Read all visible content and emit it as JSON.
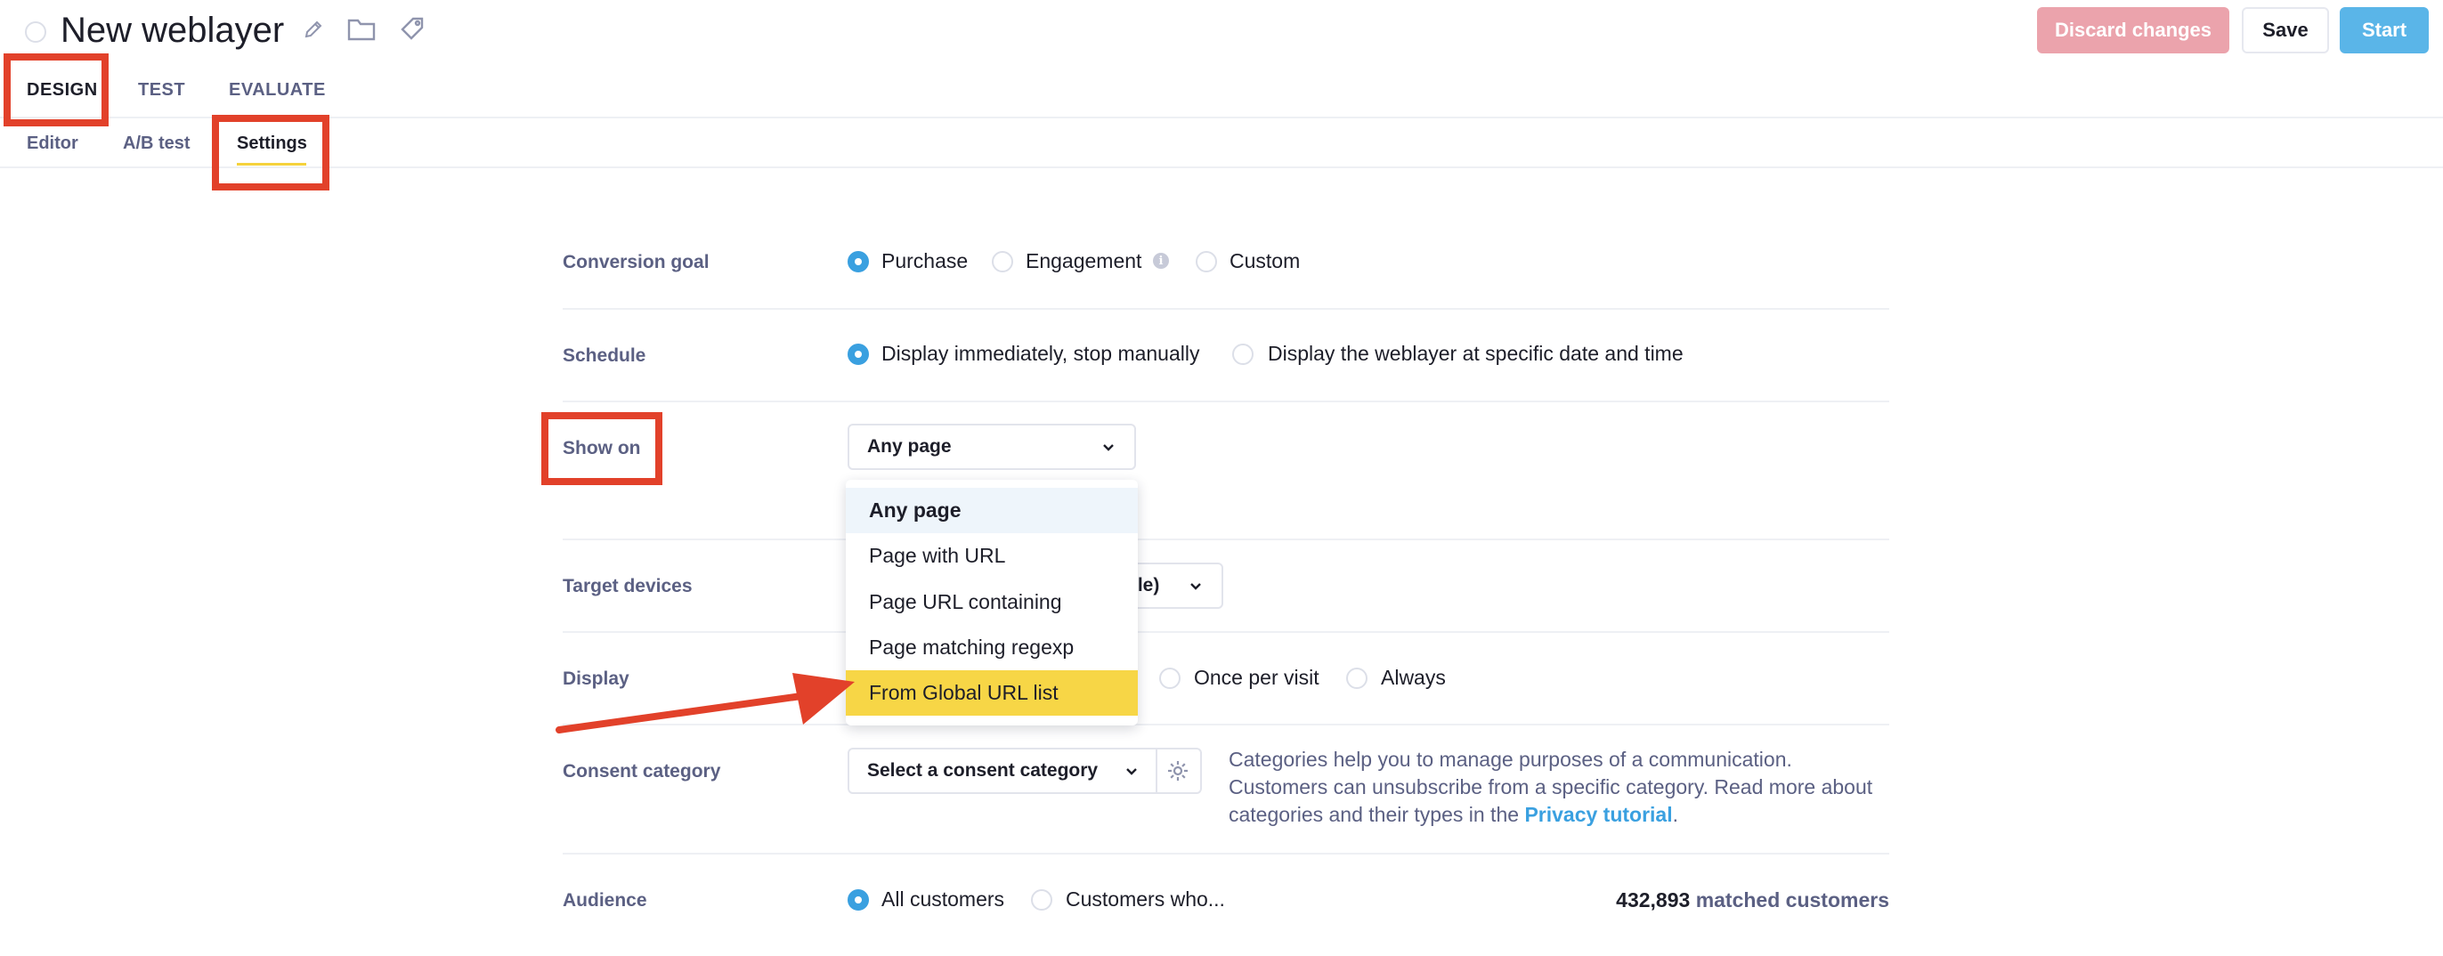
{
  "header": {
    "title": "New weblayer",
    "discard_label": "Discard changes",
    "save_label": "Save",
    "start_label": "Start"
  },
  "top_tabs": [
    {
      "label": "DESIGN",
      "active": true
    },
    {
      "label": "TEST",
      "active": false
    },
    {
      "label": "EVALUATE",
      "active": false
    }
  ],
  "sub_tabs": [
    {
      "label": "Editor",
      "active": false
    },
    {
      "label": "A/B test",
      "active": false
    },
    {
      "label": "Settings",
      "active": true
    }
  ],
  "settings": {
    "conversion_goal": {
      "label": "Conversion goal",
      "options": [
        "Purchase",
        "Engagement",
        "Custom"
      ],
      "selected": "Purchase"
    },
    "schedule": {
      "label": "Schedule",
      "options": [
        "Display immediately, stop manually",
        "Display the weblayer at specific date and time"
      ],
      "selected": "Display immediately, stop manually"
    },
    "show_on": {
      "label": "Show on",
      "value": "Any page",
      "dropdown_options": [
        "Any page",
        "Page with URL",
        "Page URL containing",
        "Page matching regexp",
        "From Global URL list"
      ],
      "highlighted_option": "From Global URL list"
    },
    "target_devices": {
      "label": "Target devices",
      "value_visible_fragment": "ile)"
    },
    "display": {
      "label": "Display",
      "options_visible": [
        "Once per visit",
        "Always"
      ]
    },
    "consent_category": {
      "label": "Consent category",
      "placeholder": "Select a consent category",
      "description": "Categories help you to manage purposes of a communication. Customers can unsubscribe from a specific category. Read more about categories and their types in the",
      "link_text": "Privacy tutorial",
      "description_end": "."
    },
    "audience": {
      "label": "Audience",
      "options": [
        "All customers",
        "Customers who..."
      ],
      "selected": "All customers",
      "matched_count": "432,893",
      "matched_label": "matched customers"
    }
  },
  "colors": {
    "annotation_red": "#e2412a",
    "highlight_yellow": "#f7d646",
    "accent_blue": "#3aa0e0",
    "discard_pink": "#eba3ac",
    "start_blue": "#5ab5e8"
  }
}
